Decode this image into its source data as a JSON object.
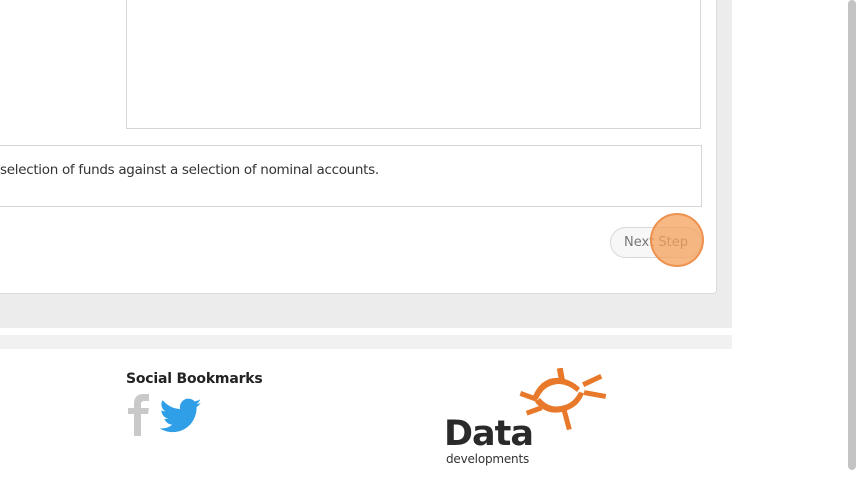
{
  "main": {
    "description": "selection of funds against a selection of nominal accounts.",
    "next_button_label": "Next Step"
  },
  "footer": {
    "social_heading": "Social Bookmarks",
    "social_icons": [
      "facebook-icon",
      "twitter-icon"
    ],
    "logo": {
      "name": "Data",
      "subtitle": "developments"
    }
  },
  "colors": {
    "logo_orange": "#e8792a",
    "twitter_blue": "#2f9fe8",
    "facebook_gray": "#c9c9c9",
    "click_indicator": "#f4a05a"
  }
}
